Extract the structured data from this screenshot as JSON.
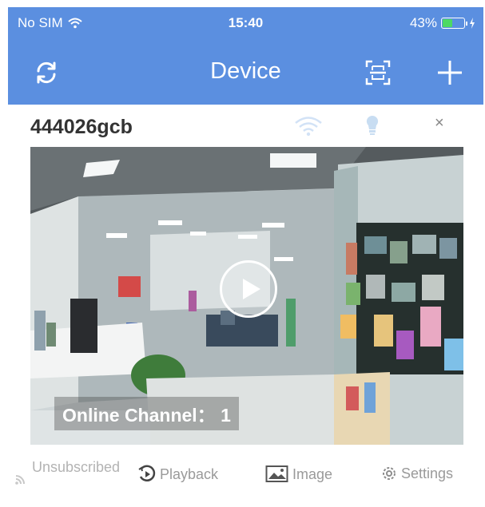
{
  "status_bar": {
    "carrier": "No SIM",
    "time": "15:40",
    "battery": "43%",
    "battery_level": 0.43,
    "battery_color": "#4cd964"
  },
  "nav": {
    "title": "Device",
    "icons": [
      "refresh-icon",
      "scan-icon",
      "add-icon"
    ],
    "color": "#5b8fe0"
  },
  "device": {
    "name": "444026gcb",
    "icons": [
      "wifi-icon",
      "bulb-icon",
      "close-icon"
    ],
    "online_label": "Online Channel： 1"
  },
  "actions": {
    "unsubscribed": "Unsubscribed",
    "playback": "Playback",
    "image": "Image",
    "settings": "Settings"
  }
}
